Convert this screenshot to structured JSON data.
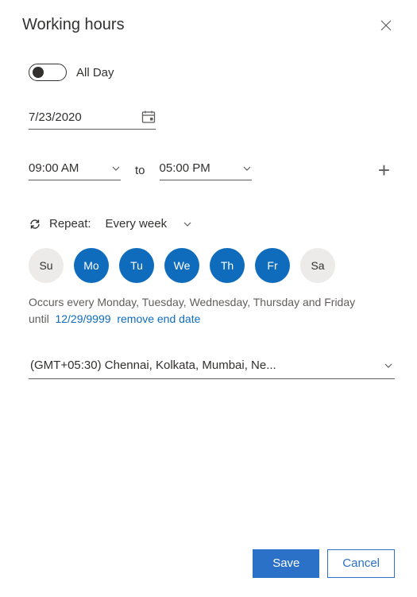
{
  "title": "Working hours",
  "allDay": {
    "label": "All Day"
  },
  "date": {
    "value": "7/23/2020"
  },
  "time": {
    "start": "09:00 AM",
    "to_label": "to",
    "end": "05:00 PM"
  },
  "repeat": {
    "label": "Repeat:",
    "value": "Every week"
  },
  "days": [
    {
      "abbr": "Su",
      "selected": false
    },
    {
      "abbr": "Mo",
      "selected": true
    },
    {
      "abbr": "Tu",
      "selected": true
    },
    {
      "abbr": "We",
      "selected": true
    },
    {
      "abbr": "Th",
      "selected": true
    },
    {
      "abbr": "Fr",
      "selected": true
    },
    {
      "abbr": "Sa",
      "selected": false
    }
  ],
  "summary": "Occurs every Monday, Tuesday, Wednesday, Thursday and Friday",
  "until": {
    "label": "until",
    "date": "12/29/9999",
    "remove_label": "remove end date"
  },
  "timezone": {
    "value": "(GMT+05:30) Chennai, Kolkata, Mumbai, Ne..."
  },
  "buttons": {
    "save": "Save",
    "cancel": "Cancel"
  }
}
